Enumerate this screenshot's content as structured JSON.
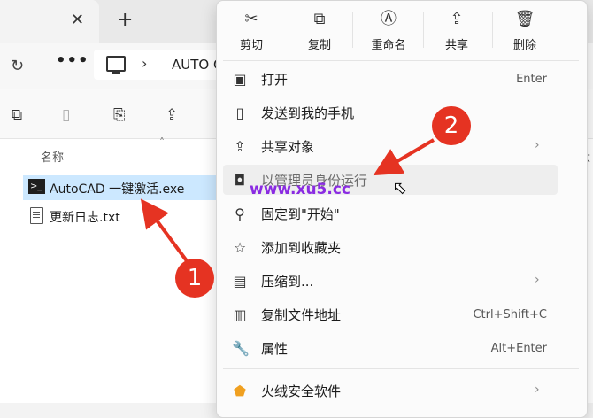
{
  "explorer": {
    "tab_close": "✕",
    "tab_add": "+",
    "refresh": "↻",
    "more": "•••",
    "address_sep": "›",
    "address_text": "AUTO C",
    "column_name": "名称",
    "column_size_partial": "大",
    "sort_caret": "˄",
    "files": [
      {
        "name": "AutoCAD 一键激活.exe",
        "selected": true
      },
      {
        "name": "更新日志.txt",
        "selected": false
      }
    ]
  },
  "context_menu": {
    "quick_actions": [
      {
        "label": "剪切",
        "icon": "scissors-icon"
      },
      {
        "label": "复制",
        "icon": "copy-icon"
      },
      {
        "label": "重命名",
        "icon": "rename-icon"
      },
      {
        "label": "共享",
        "icon": "share-icon"
      },
      {
        "label": "删除",
        "icon": "trash-icon"
      }
    ],
    "items": [
      {
        "label": "打开",
        "accel": "Enter",
        "icon": "app-icon"
      },
      {
        "label": "发送到我的手机",
        "accel": "",
        "icon": "phone-icon"
      },
      {
        "label": "共享对象",
        "accel": "",
        "icon": "share-icon",
        "submenu": true
      },
      {
        "label": "以管理员身份运行",
        "accel": "",
        "icon": "shield-icon",
        "hover": true
      },
      {
        "label": "固定到\"开始\"",
        "accel": "",
        "icon": "pin-icon"
      },
      {
        "label": "添加到收藏夹",
        "accel": "",
        "icon": "star-icon"
      },
      {
        "label": "压缩到...",
        "accel": "",
        "icon": "zip-icon",
        "submenu": true
      },
      {
        "label": "复制文件地址",
        "accel": "Ctrl+Shift+C",
        "icon": "path-icon"
      },
      {
        "label": "属性",
        "accel": "Alt+Enter",
        "icon": "wrench-icon"
      },
      {
        "label": "火绒安全软件",
        "accel": "",
        "icon": "huorong-icon",
        "submenu": true
      }
    ]
  },
  "annotations": {
    "badge_1": "1",
    "badge_2": "2",
    "color": "#e53322"
  },
  "watermark": "www.xu5.cc"
}
